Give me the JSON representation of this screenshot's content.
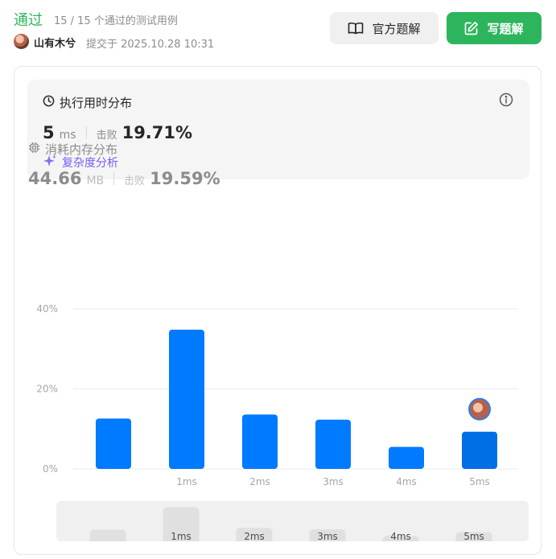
{
  "header": {
    "status": "通过",
    "subinfo": "15 / 15 个通过的测试用例",
    "author": "山有木兮",
    "submitted": "提交于 2025.10.28 10:31",
    "official_btn": "官方题解",
    "write_btn": "写题解"
  },
  "runtime": {
    "title": "执行用时分布",
    "value": "5",
    "unit": "ms",
    "beat_label": "击败",
    "beat_value": "19.71%",
    "complexity_label": "复杂度分析"
  },
  "memory": {
    "title": "消耗内存分布",
    "value": "44.66",
    "unit": "MB",
    "beat_label": "击败",
    "beat_value": "19.59%"
  },
  "colors": {
    "accent_green": "#2db55d",
    "bar_blue": "#007aff",
    "bar_selected": "#006ee6",
    "purple": "#7a5af8"
  },
  "chart_data": {
    "type": "bar",
    "categories": [
      "",
      "1ms",
      "2ms",
      "3ms",
      "4ms",
      "5ms"
    ],
    "values": [
      12.6,
      34.8,
      13.6,
      12.3,
      5.5,
      9.3
    ],
    "y_ticks": [
      "40%",
      "20%",
      "0%"
    ],
    "ylim": [
      0,
      40
    ],
    "highlighted": "5ms",
    "mini_values": [
      4.1,
      12.1,
      4.8,
      4.3,
      1.9,
      3.3
    ]
  }
}
